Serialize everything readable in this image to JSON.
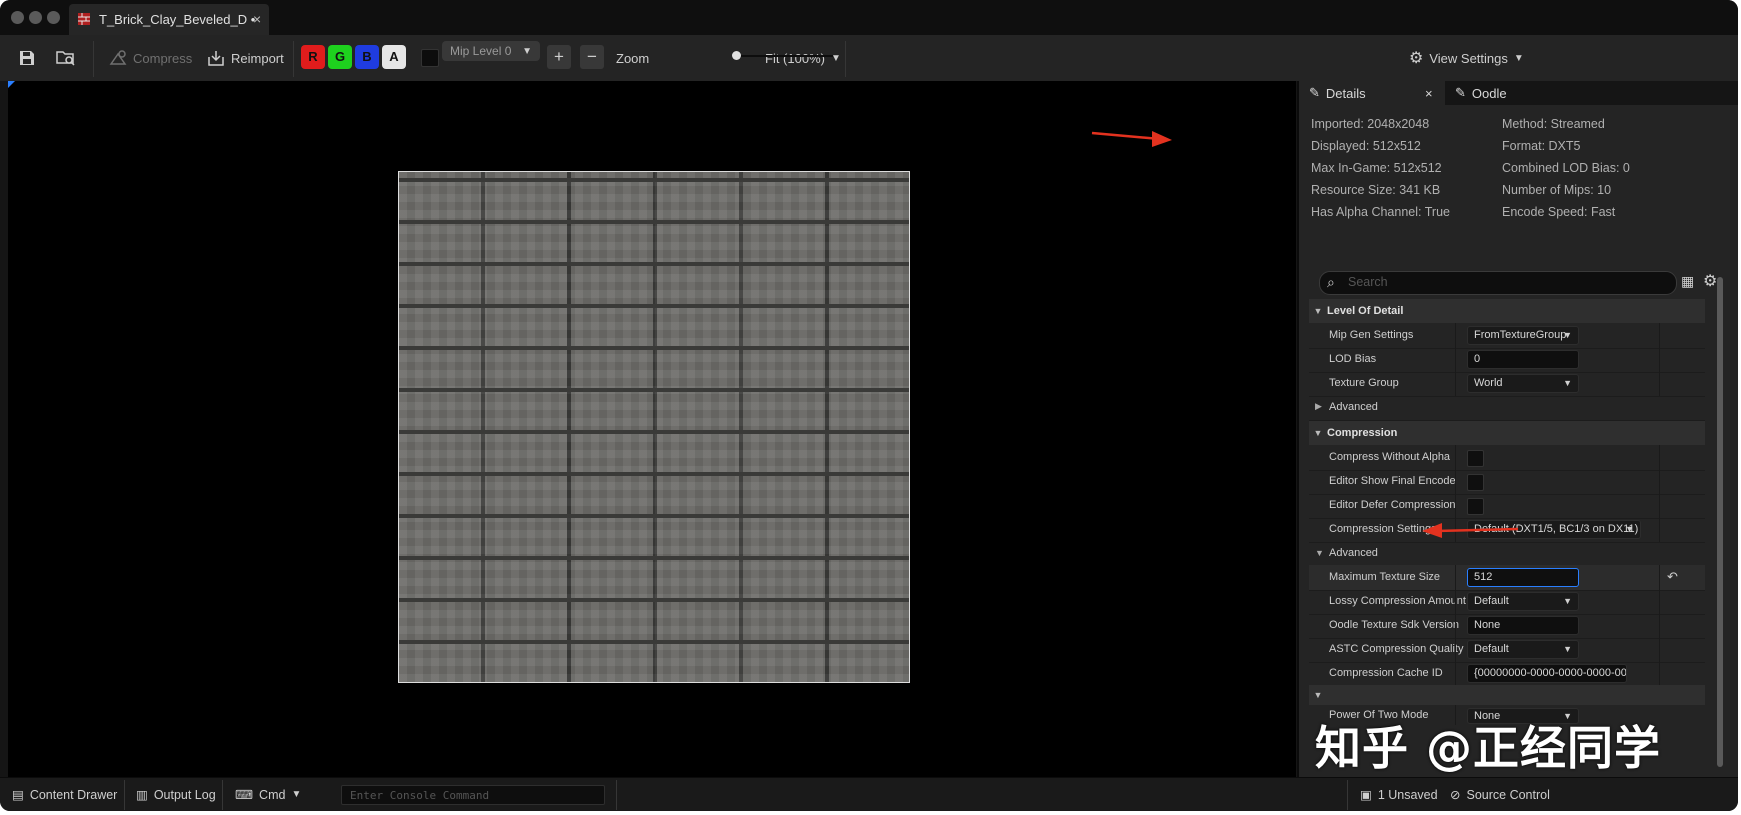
{
  "titlebar": {
    "tab_title": "T_Brick_Clay_Beveled_D",
    "tab_modified": "•",
    "tab_close": "×"
  },
  "toolbar": {
    "compress_label": "Compress",
    "reimport_label": "Reimport",
    "channels": [
      {
        "label": "R",
        "color": "#e01c1c"
      },
      {
        "label": "G",
        "color": "#1ed11e"
      },
      {
        "label": "B",
        "color": "#1f3ce0"
      },
      {
        "label": "A",
        "color": "#e6e6e6"
      }
    ],
    "mip_level": "Mip Level 0",
    "plus": "+",
    "minus": "−",
    "zoom_label": "Zoom",
    "zoom_value": "Fit (100%)",
    "view_settings_label": "View Settings"
  },
  "panel": {
    "tabs": [
      {
        "label": "Details",
        "close": "×"
      },
      {
        "label": "Oodle"
      }
    ],
    "info_left": [
      "Imported: 2048x2048",
      "Displayed: 512x512",
      "Max In-Game: 512x512",
      "Resource Size: 341 KB",
      "Has Alpha Channel: True"
    ],
    "info_right": [
      "Method: Streamed",
      "Format: DXT5",
      "Combined LOD Bias: 0",
      "Number of Mips: 10",
      "Encode Speed: Fast"
    ],
    "search_placeholder": "Search",
    "categories": {
      "level_of_detail": "Level Of Detail",
      "compression": "Compression"
    },
    "lod_rows": {
      "mip_gen": {
        "label": "Mip Gen Settings",
        "value": "FromTextureGroup"
      },
      "lod_bias": {
        "label": "LOD Bias",
        "value": "0"
      },
      "texture_group": {
        "label": "Texture Group",
        "value": "World"
      },
      "advanced": "Advanced"
    },
    "compression_rows": {
      "without_alpha": "Compress Without Alpha",
      "show_final": "Editor Show Final Encode",
      "defer": "Editor Defer Compression",
      "settings": {
        "label": "Compression Settings",
        "value": "Default (DXT1/5, BC1/3 on DX11)"
      },
      "advanced": "Advanced",
      "max_size": {
        "label": "Maximum Texture Size",
        "value": "512"
      },
      "lossy": {
        "label": "Lossy Compression Amount",
        "value": "Default"
      },
      "oodle_sdk": {
        "label": "Oodle Texture Sdk Version",
        "value": "None"
      },
      "astc": {
        "label": "ASTC Compression Quality",
        "value": "Default"
      },
      "cache_id": {
        "label": "Compression Cache ID",
        "value": "{00000000-0000-0000-0000-00"
      },
      "power_two": {
        "label": "Power Of Two Mode",
        "value": "None"
      }
    }
  },
  "bottom": {
    "content_drawer": "Content Drawer",
    "output_log": "Output Log",
    "cmd": "Cmd",
    "console_placeholder": "Enter Console Command",
    "unsaved": "1 Unsaved",
    "source_control": "Source Control"
  },
  "watermark": "知乎 @正经同学",
  "colors": {
    "accent": "#2a7fff",
    "annotation_arrow": "#e3321f"
  }
}
